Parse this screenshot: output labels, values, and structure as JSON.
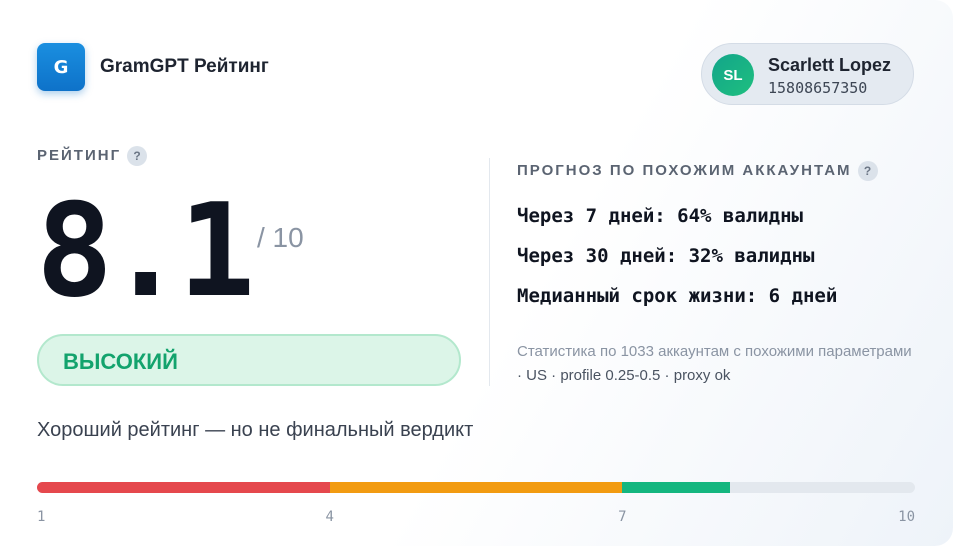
{
  "header": {
    "logo_letter": "G",
    "app_title": "GramGPT Рейтинг"
  },
  "user": {
    "initials": "SL",
    "name": "Scarlett Lopez",
    "phone": "15808657350"
  },
  "rating": {
    "label": "РЕЙТИНГ",
    "help_glyph": "?",
    "score": "8.1",
    "score_max": "/ 10",
    "level": "ВЫСОКИЙ",
    "verdict": "Хороший рейтинг — но не финальный вердикт"
  },
  "forecast": {
    "label": "ПРОГНОЗ ПО ПОХОЖИМ АККАУНТАМ",
    "help_glyph": "?",
    "lines": [
      "Через 7 дней: 64% валидны",
      "Через 30 дней: 32% валидны",
      "Медианный срок жизни: 6 дней"
    ],
    "stats_text": "Статистика по 1033 аккаунтам с похожими параметрами",
    "stats_meta": "· US · profile 0.25-0.5 · proxy ok"
  },
  "scale": {
    "min": 1,
    "max": 10,
    "value": 8.1,
    "tick_labels": [
      "1",
      "4",
      "7",
      "10"
    ],
    "segments": [
      {
        "from": 1,
        "to": 4,
        "color": "#e5484d"
      },
      {
        "from": 4,
        "to": 7,
        "color": "#f29b11"
      },
      {
        "from": 7,
        "to": 8.1,
        "color": "#14b67f"
      }
    ],
    "track_color": "#e3e8ee"
  },
  "colors": {
    "accent_blue": "#0e72c9",
    "success_green": "#13a36d"
  }
}
